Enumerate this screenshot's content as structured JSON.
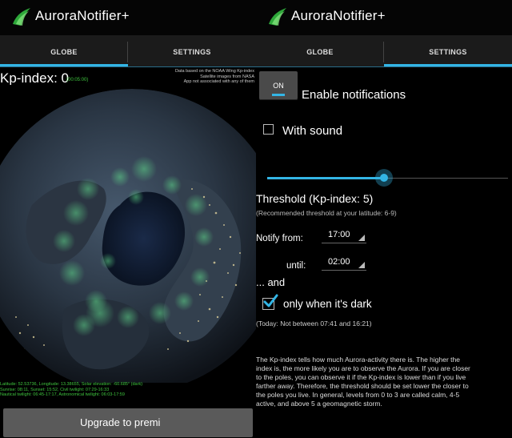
{
  "app": {
    "title": "AuroraNotifier+",
    "accent_color": "#33b5e5",
    "icon": "aurora-app-icon"
  },
  "tabs": [
    {
      "label": "GLOBE"
    },
    {
      "label": "SETTINGS"
    }
  ],
  "globe": {
    "kp_label": "Kp-index: 0",
    "kp_time": "(00:05:00)",
    "credits": [
      "Data based on the NOAA Wing Kp-index",
      "Satellite images from NASA",
      "App not associated with any of them"
    ],
    "location_lines": [
      "Latitude: 52.53736, Longitude: 13.38655, Solar elevation: -60.685° (dark)",
      "Sunrise: 08:11, Sunset: 15:52, Civil twilight: 07:29-16:33",
      "Nautical twilight: 06:45-17:17, Astronomical twilight: 06:03-17:59"
    ],
    "upgrade_label": "Upgrade to premi"
  },
  "settings": {
    "toggle_label": "ON",
    "enable_label": "Enable notifications",
    "sound_label": "With sound",
    "slider_value": 5,
    "slider_min": 0,
    "slider_max": 9,
    "threshold_title": "Threshold (Kp-index: 5)",
    "threshold_sub": "(Recommended threshold at your latitude: 6-9)",
    "notify_from_label": "Notify from:",
    "from_time": "17:00",
    "until_label": "until:",
    "until_time": "02:00",
    "and_label": "... and",
    "dark_label": "only when it's dark",
    "today_text": "(Today: Not between 07:41 and 16:21)",
    "info_lines": [
      "The Kp-index tells how much Aurora-activity there is. The higher the",
      "index is, the more likely you are to observe the Aurora. If you are closer",
      "to the poles, you can observe it if the Kp-index is lower than if you live",
      "farther away. Therefore, the threshold should be set lower the closer to",
      "the poles you live. In general, levels from 0 to 3 are called calm, 4-5",
      "active, and above 5 a geomagnetic storm."
    ]
  }
}
